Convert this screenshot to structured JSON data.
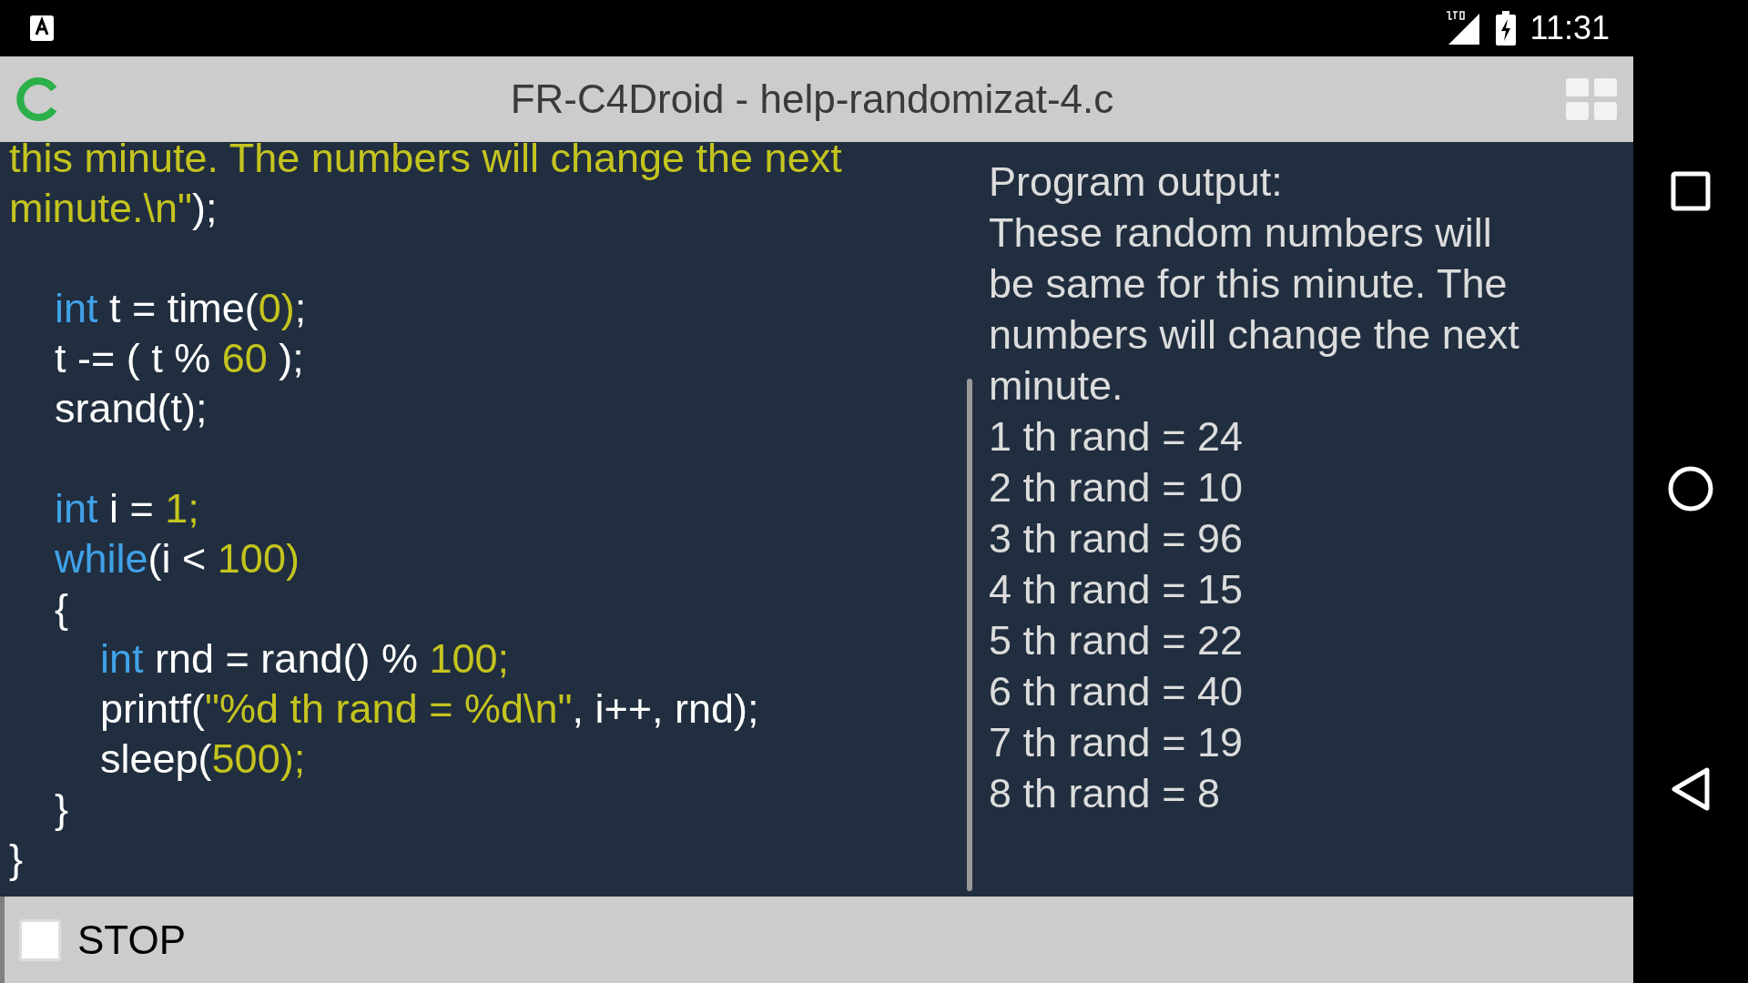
{
  "status_bar": {
    "time": "11:31"
  },
  "toolbar": {
    "title": "FR-C4Droid - help-randomizat-4.c"
  },
  "code": {
    "lines": [
      {
        "kind": "code",
        "tokens": [
          {
            "kind": "literal",
            "text": "this minute. The numbers will change the next"
          }
        ]
      },
      {
        "kind": "code",
        "tokens": [
          {
            "kind": "literal",
            "text": "minute.\\n\""
          },
          {
            "kind": "plain",
            "text": ");"
          }
        ]
      },
      {
        "kind": "blank"
      },
      {
        "kind": "code",
        "tokens": [
          {
            "kind": "keyword",
            "text": "    int"
          },
          {
            "kind": "plain",
            "text": " t = time("
          },
          {
            "kind": "literal",
            "text": "0)"
          },
          {
            "kind": "plain",
            "text": ";"
          }
        ]
      },
      {
        "kind": "code",
        "tokens": [
          {
            "kind": "plain",
            "text": "    t -= ( t % "
          },
          {
            "kind": "literal",
            "text": "60"
          },
          {
            "kind": "plain",
            "text": " );"
          }
        ]
      },
      {
        "kind": "code",
        "tokens": [
          {
            "kind": "plain",
            "text": "    srand(t);"
          }
        ]
      },
      {
        "kind": "blank"
      },
      {
        "kind": "code",
        "tokens": [
          {
            "kind": "keyword",
            "text": "    int"
          },
          {
            "kind": "plain",
            "text": " i = "
          },
          {
            "kind": "literal",
            "text": "1;"
          }
        ]
      },
      {
        "kind": "code",
        "tokens": [
          {
            "kind": "keyword",
            "text": "    while"
          },
          {
            "kind": "plain",
            "text": "(i < "
          },
          {
            "kind": "literal",
            "text": "100)"
          }
        ]
      },
      {
        "kind": "code",
        "tokens": [
          {
            "kind": "plain",
            "text": "    {"
          }
        ]
      },
      {
        "kind": "code",
        "tokens": [
          {
            "kind": "keyword",
            "text": "        int"
          },
          {
            "kind": "plain",
            "text": " rnd = rand() % "
          },
          {
            "kind": "literal",
            "text": "100;"
          }
        ]
      },
      {
        "kind": "code",
        "tokens": [
          {
            "kind": "plain",
            "text": "        printf("
          },
          {
            "kind": "literal",
            "text": "\"%d th rand = %d\\n\""
          },
          {
            "kind": "plain",
            "text": ", i++, rnd);"
          }
        ]
      },
      {
        "kind": "code",
        "tokens": [
          {
            "kind": "plain",
            "text": "        sleep("
          },
          {
            "kind": "literal",
            "text": "500);"
          }
        ]
      },
      {
        "kind": "code",
        "tokens": [
          {
            "kind": "plain",
            "text": "    }"
          }
        ]
      },
      {
        "kind": "code",
        "tokens": [
          {
            "kind": "plain",
            "text": "}"
          }
        ]
      }
    ]
  },
  "output": {
    "lines": [
      "Program output:",
      "These random numbers will",
      "be same for this minute. The",
      "numbers will change the next",
      "minute.",
      "1 th rand = 24",
      "2 th rand = 10",
      "3 th rand = 96",
      "4 th rand = 15",
      "5 th rand = 22",
      "6 th rand = 40",
      "7 th rand = 19",
      "8 th rand = 8"
    ]
  },
  "stop": {
    "label": "STOP",
    "checked": false
  }
}
